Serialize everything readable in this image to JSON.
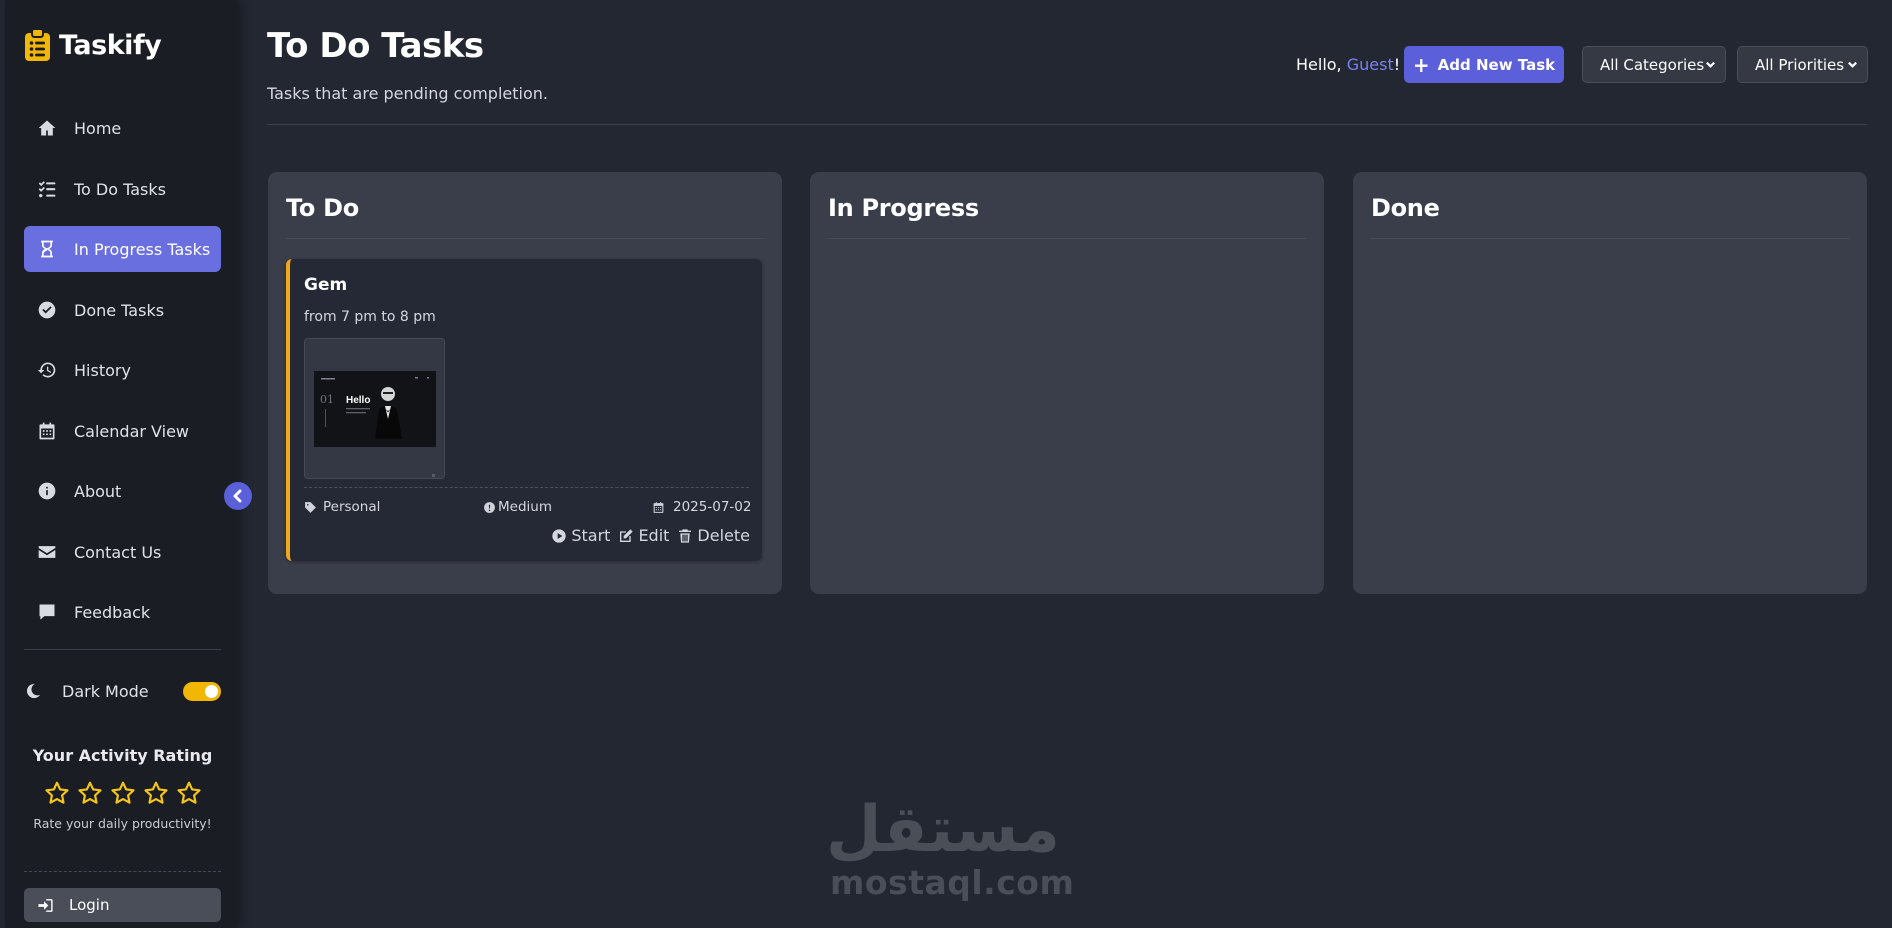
{
  "brand": {
    "name": "Taskify"
  },
  "sidebar": {
    "items": [
      {
        "label": "Home",
        "icon": "home-icon"
      },
      {
        "label": "To Do Tasks",
        "icon": "list-check-icon"
      },
      {
        "label": "In Progress Tasks",
        "icon": "hourglass-icon",
        "active": true
      },
      {
        "label": "Done Tasks",
        "icon": "check-circle-icon"
      },
      {
        "label": "History",
        "icon": "history-icon"
      },
      {
        "label": "Calendar View",
        "icon": "calendar-icon"
      },
      {
        "label": "About",
        "icon": "info-icon"
      },
      {
        "label": "Contact Us",
        "icon": "envelope-icon"
      },
      {
        "label": "Feedback",
        "icon": "comment-icon"
      }
    ],
    "dark_mode_label": "Dark Mode",
    "dark_mode_on": true,
    "rating_title": "Your Activity Rating",
    "rating_subtitle": "Rate your daily productivity!",
    "rating_value": 0,
    "rating_max": 5,
    "login_label": "Login"
  },
  "header": {
    "title": "To Do Tasks",
    "subtitle": "Tasks that are pending completion.",
    "greeting_prefix": "Hello, ",
    "greeting_name": "Guest",
    "greeting_suffix": "!",
    "add_button": "Add New Task",
    "category_filter": "All Categories",
    "priority_filter": "All Priorities"
  },
  "columns": [
    {
      "title": "To Do"
    },
    {
      "title": "In Progress"
    },
    {
      "title": "Done"
    }
  ],
  "task": {
    "title": "Gem",
    "description": "from 7 pm to 8 pm",
    "thumbnail_text": "Hello",
    "thumbnail_number": "01",
    "category": "Personal",
    "priority": "Medium",
    "date": "2025-07-02",
    "actions": {
      "start": "Start",
      "edit": "Edit",
      "delete": "Delete"
    }
  },
  "watermark": {
    "arabic": "مستقل",
    "latin": "mostaql.com"
  },
  "colors": {
    "accent": "#5b60da",
    "accent_light": "#7b80f0",
    "card_border": "#f0a81c",
    "toggle": "#f2b705",
    "star": "#f5c518"
  }
}
